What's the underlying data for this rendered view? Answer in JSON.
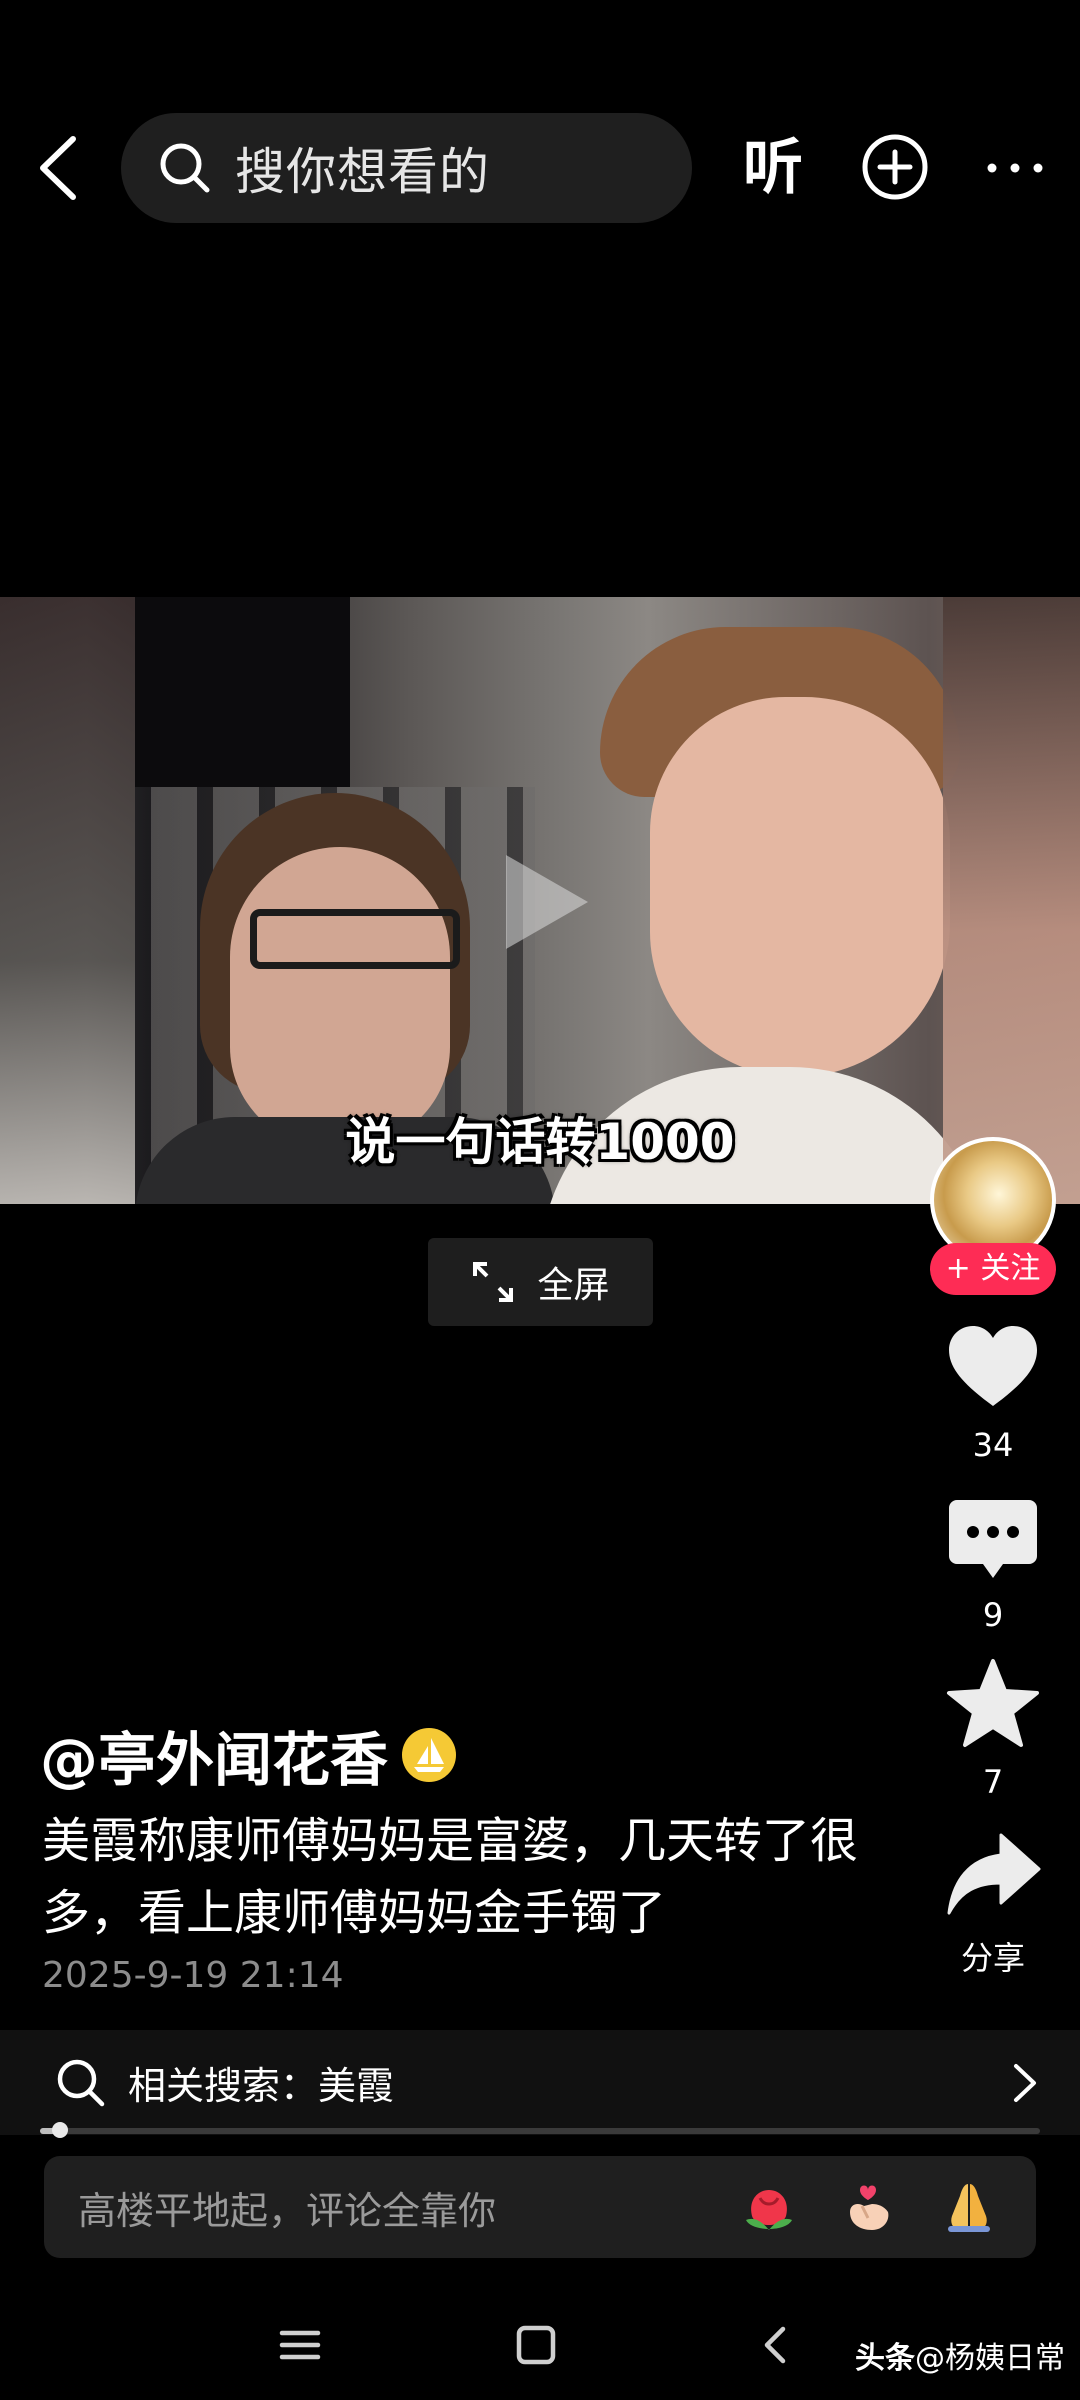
{
  "top_bar": {
    "back_icon": "chevron-left-icon",
    "search_icon": "search-icon",
    "search_placeholder": "搜你想看的",
    "listen_label": "听",
    "add_icon": "plus-circle-icon",
    "more_icon": "more-dots-icon"
  },
  "video": {
    "subtitle": "说一句话转1000",
    "play_icon": "play-icon"
  },
  "fullscreen": {
    "icon": "expand-icon",
    "label": "全屏"
  },
  "actions": {
    "follow_label": "+ 关注",
    "like_count": "34",
    "comment_count": "9",
    "favorite_count": "7",
    "share_label": "分享",
    "follow_color": "#fe2c55"
  },
  "post": {
    "author": "@亭外闻花香",
    "caption": "美霞称康师傅妈妈是富婆，几天转了很多，看上康师傅妈妈金手镯了",
    "timestamp": "2025-9-19 21:14"
  },
  "related_search": {
    "label": "相关搜索：美霞",
    "arrow_icon": "chevron-right-icon"
  },
  "playback": {
    "progress": 0.02
  },
  "comment_input": {
    "placeholder": "高楼平地起，评论全靠你",
    "quick_emojis": [
      "rose-emoji",
      "finger-heart-emoji",
      "pray-emoji"
    ]
  },
  "system_nav": {
    "recent_icon": "menu-lines-icon",
    "home_icon": "square-home-icon",
    "back_icon": "chevron-left-icon"
  },
  "watermark": {
    "brand": "头条",
    "handle": "@杨姨日常"
  }
}
